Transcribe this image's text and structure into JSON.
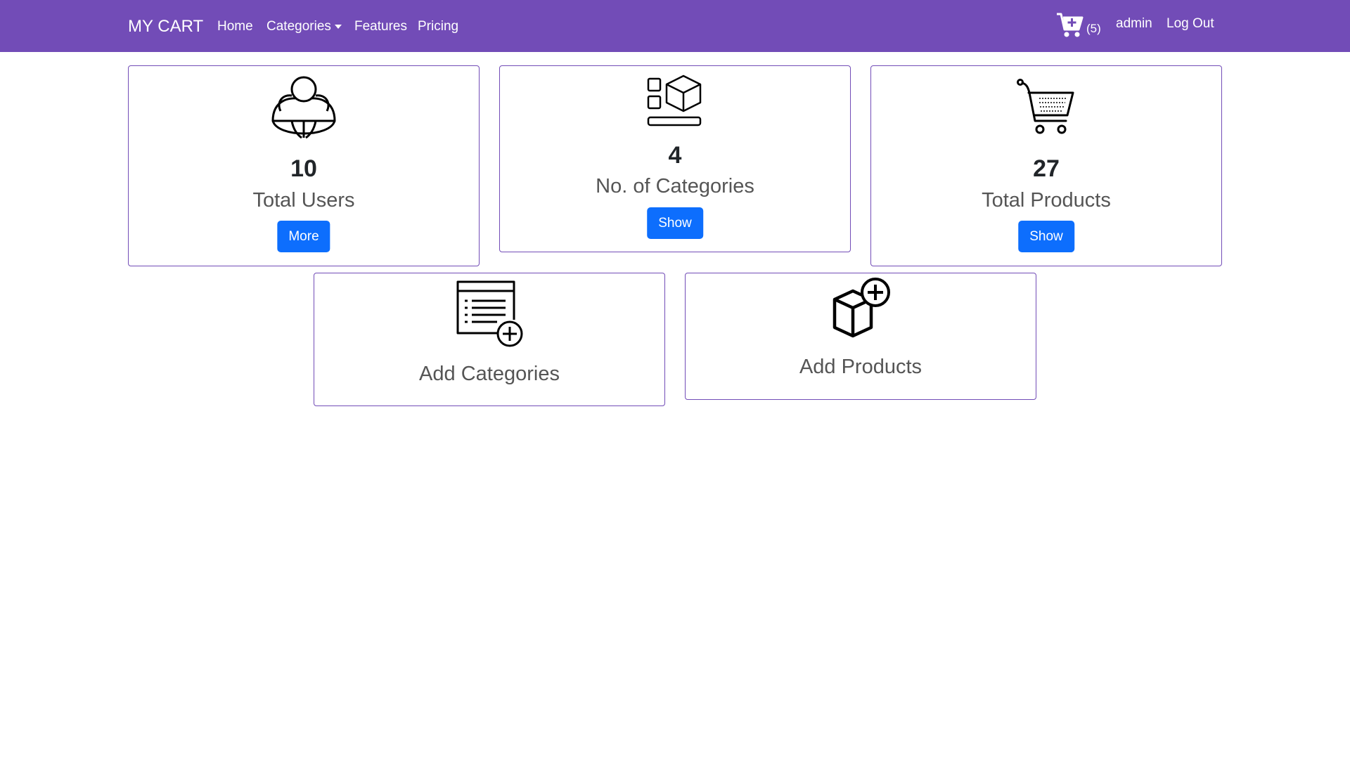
{
  "navbar": {
    "brand": "MY CART",
    "links": [
      "Home",
      "Categories",
      "Features",
      "Pricing"
    ],
    "cart_count": "(5)",
    "user": "admin",
    "logout": "Log Out",
    "background": "#724cb7"
  },
  "cards": {
    "users": {
      "count": "10",
      "label": "Total Users",
      "button": "More",
      "icon": "users-icon"
    },
    "categories": {
      "count": "4",
      "label": "No. of Categories",
      "button": "Show",
      "icon": "categories-icon"
    },
    "products": {
      "count": "27",
      "label": "Total Products",
      "button": "Show",
      "icon": "shopping-cart-icon"
    },
    "add_categories": {
      "label": "Add Categories",
      "icon": "add-list-icon"
    },
    "add_products": {
      "label": "Add Products",
      "icon": "add-box-icon"
    }
  },
  "colors": {
    "accent": "#724cb7",
    "button": "#0d6efd"
  }
}
